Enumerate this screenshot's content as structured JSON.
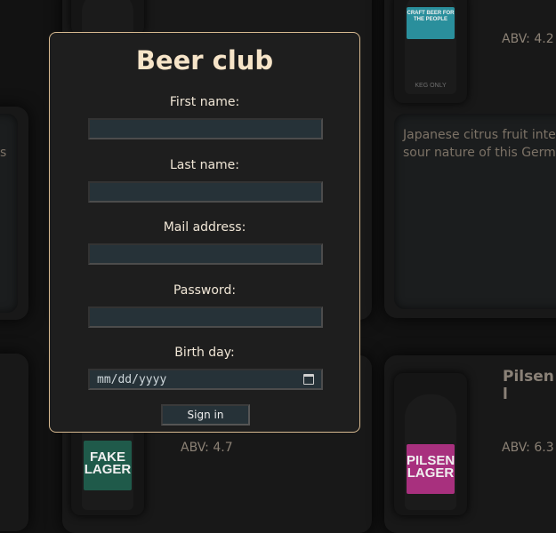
{
  "modal": {
    "title": "Beer club",
    "fields": [
      {
        "label": "First name:",
        "value": ""
      },
      {
        "label": "Last name:",
        "value": ""
      },
      {
        "label": "Mail address:",
        "value": ""
      },
      {
        "label": "Password:",
        "value": ""
      },
      {
        "label": "Birth day:",
        "placeholder": "mm/dd/yyyy"
      }
    ],
    "submit_label": "Sign in"
  },
  "background": {
    "top_right_abv": "ABV: 4.2",
    "top_right_label_text": "CRAFT BEER FOR THE PEOPLE",
    "top_right_bottom_text": "KEG ONLY",
    "description_lines": [
      "Japanese citrus fruit inte",
      "sour nature of this Germ"
    ],
    "left_card_fragment": "s",
    "bottom_left_abv": "ABV: 4.7",
    "bottom_left_label": "FAKE LAGER",
    "bottom_right_name": "Pilsen l",
    "bottom_right_abv": "ABV: 6.3",
    "bottom_right_label": "PILSEN LAGER"
  },
  "colors": {
    "accent": "#d7b990",
    "title": "#f6e4c8",
    "input_bg": "#263238",
    "page_bg": "#121212"
  },
  "icons": {
    "calendar": "calendar-icon"
  }
}
